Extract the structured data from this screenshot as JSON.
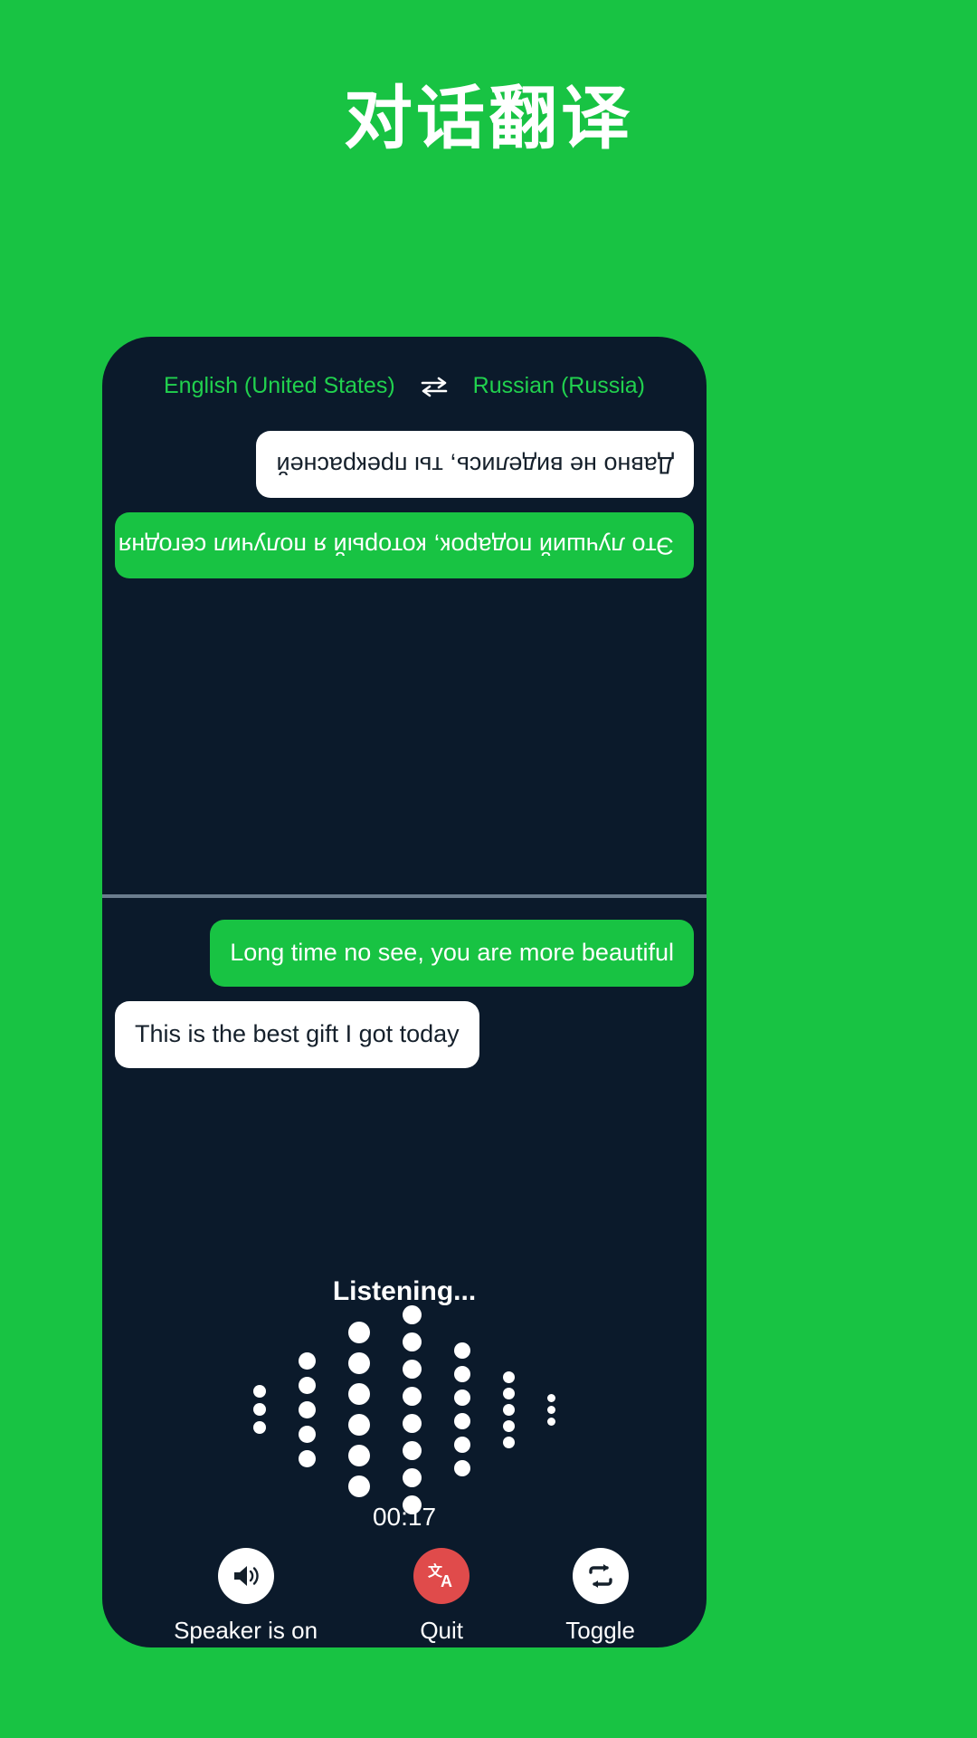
{
  "page": {
    "title": "对话翻译",
    "background_color": "#18c343"
  },
  "card": {
    "background_color": "#0b1a2b"
  },
  "language_bar": {
    "source_language": "English (United States)",
    "target_language": "Russian (Russia)",
    "swap_icon": "swap-horizontal-icon",
    "text_color": "#21d14e"
  },
  "conversation": {
    "top_panel_rotated": true,
    "top_messages": [
      {
        "text": "Это лучший подарок, который я получил сегодня",
        "style": "green",
        "align": "right"
      },
      {
        "text": "Давно не виделись, ты прекрасней",
        "style": "white",
        "align": "left"
      }
    ],
    "bottom_messages": [
      {
        "text": "Long time no see, you are more beautiful",
        "style": "green",
        "align": "right"
      },
      {
        "text": "This is the best gift I got today",
        "style": "white",
        "align": "left"
      }
    ]
  },
  "listening": {
    "label": "Listening...",
    "timer": "00:17",
    "waveform": {
      "dot_color": "#ffffff",
      "columns": [
        {
          "count": 3,
          "size": 14
        },
        {
          "count": 5,
          "size": 19
        },
        {
          "count": 6,
          "size": 24
        },
        {
          "count": 8,
          "size": 21
        },
        {
          "count": 6,
          "size": 18
        },
        {
          "count": 5,
          "size": 13
        },
        {
          "count": 3,
          "size": 9
        }
      ]
    }
  },
  "controls": [
    {
      "label": "Speaker is on",
      "icon": "speaker-on-icon",
      "circle_style": "white",
      "circle_color": "#ffffff"
    },
    {
      "label": "Quit",
      "icon": "translate-icon",
      "circle_style": "red",
      "circle_color": "#e04b4b"
    },
    {
      "label": "Toggle",
      "icon": "repeat-swap-icon",
      "circle_style": "white",
      "circle_color": "#ffffff"
    }
  ]
}
